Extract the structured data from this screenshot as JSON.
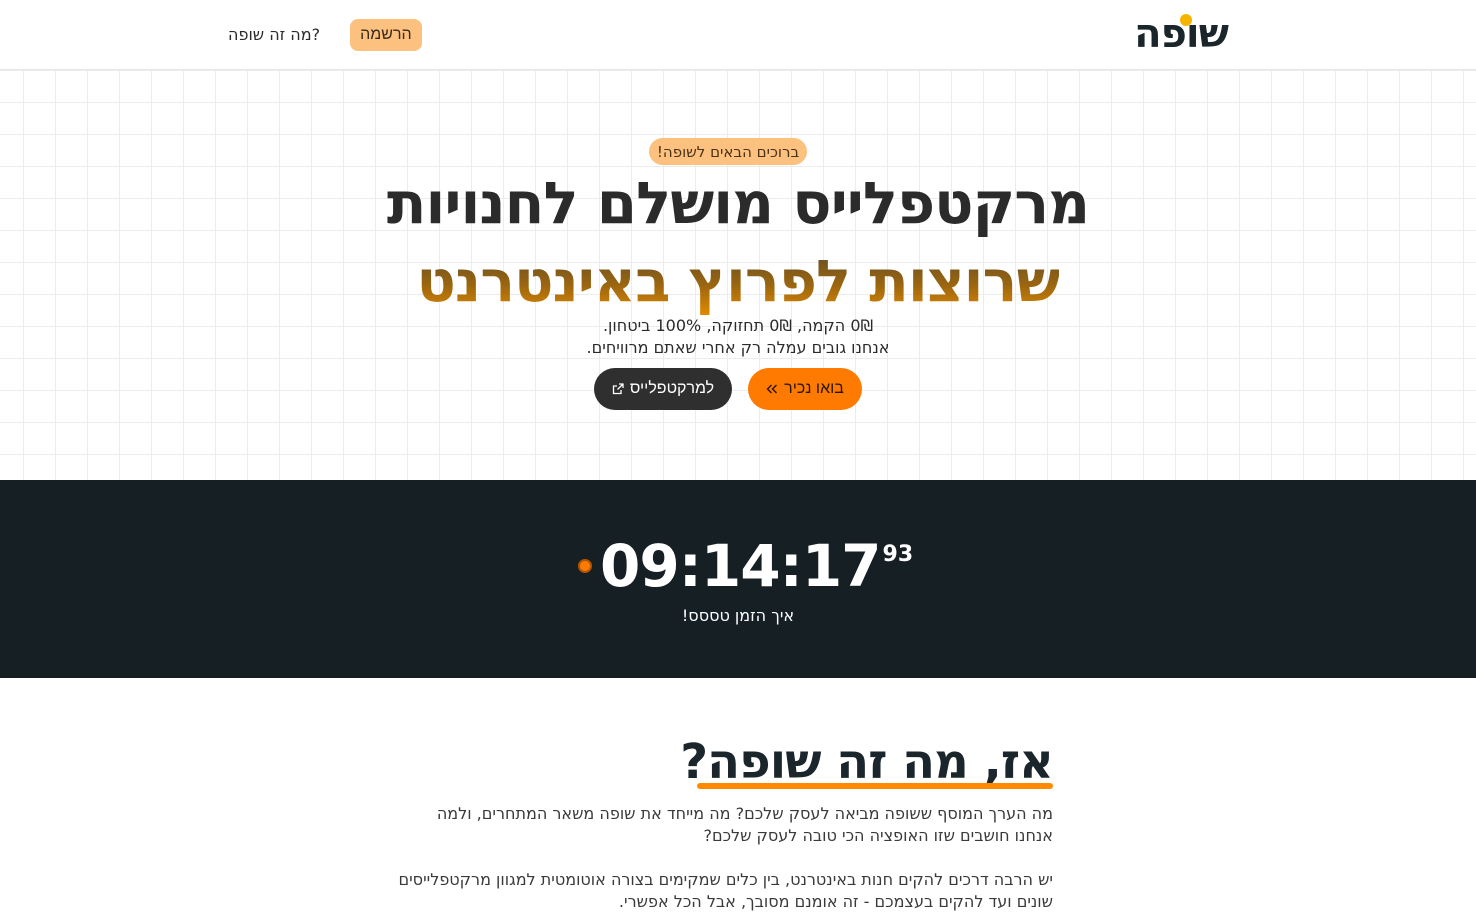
{
  "brand": {
    "logo_text": "שופה",
    "accent_color": "#ff7a00",
    "dot_color": "#f5b400"
  },
  "nav": {
    "register_label": "הרשמה",
    "what_is_label": "מה זה שופה?"
  },
  "hero": {
    "badge": "ברוכים הבאים לשופה!",
    "title_line1": "מרקטפלייס מושלם לחנויות",
    "title_line2": "שרוצות לפרוץ באינטרנט",
    "subtitle_line1": "0₪ הקמה, 0₪ תחזוקה, 100% ביטחון.",
    "subtitle_line2": "אנחנו גובים עמלה רק אחרי שאתם מרוויחים.",
    "btn_marketplace": "למרקטפלייס",
    "btn_marketplace_icon": "external-link-icon",
    "btn_know": "בואו נכיר",
    "btn_know_icon": "double-chevron-left-icon"
  },
  "timer": {
    "time": "09:14:17",
    "fraction": "93",
    "caption": "איך הזמן טססס!"
  },
  "about": {
    "title": "אז, מה זה שופה?",
    "paragraph1": "מה הערך המוסף ששופה מביאה לעסק שלכם? מה מייחד את שופה משאר המתחרים, ולמה אנחנו חושבים שזו האופציה הכי טובה לעסק שלכם?",
    "paragraph2": "יש הרבה דרכים להקים חנות באינטרנט, בין כלים שמקימים בצורה אוטומטית למגוון מרקטפלייסים שונים ועד להקים בעצמכם - זה אומנם מסובך, אבל הכל אפשרי."
  }
}
